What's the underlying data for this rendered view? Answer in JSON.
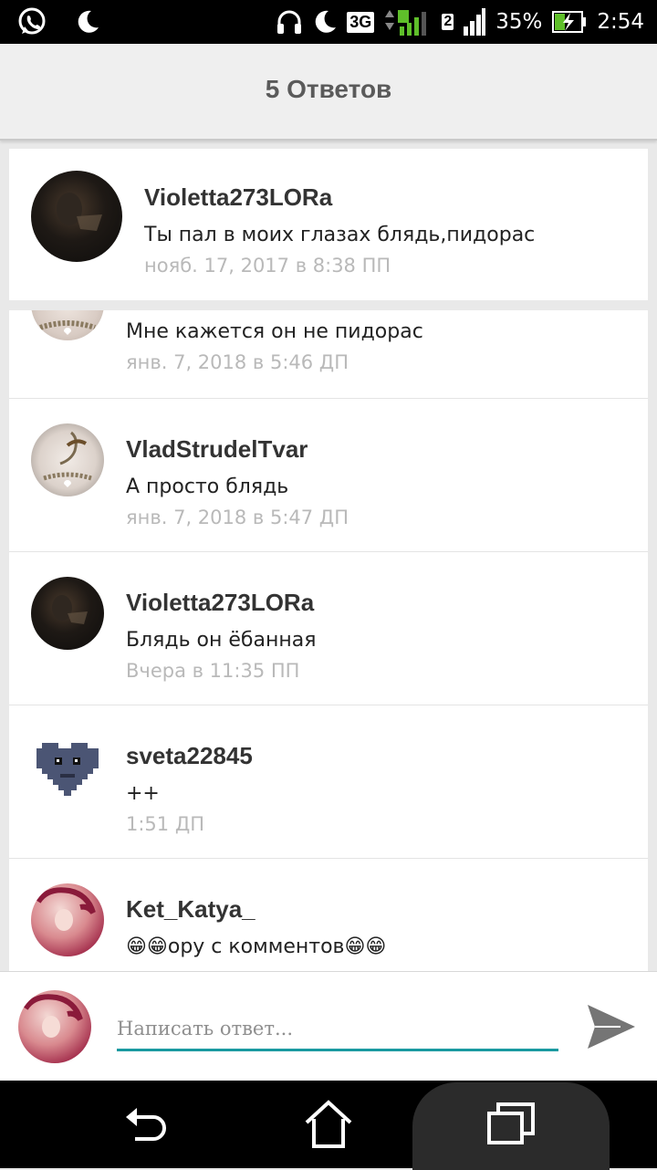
{
  "status_bar": {
    "network": "3G",
    "battery": "35%",
    "time": "2:54",
    "sim2": "2",
    "icons": [
      "whatsapp-icon",
      "moon-icon",
      "headphones-icon",
      "moon-icon",
      "signal-icon",
      "battery-charging-icon"
    ]
  },
  "header": {
    "title": "5 Ответов"
  },
  "main_comment": {
    "username": "Violetta273LORa",
    "text": "Ты пал в моих глазах блядь,пидорас",
    "time": "нояб. 17, 2017 в 8:38 ПП"
  },
  "replies": [
    {
      "username": "",
      "text": "Мне кажется он не пидорас",
      "time": "янв. 7, 2018 в 5:46 ДП",
      "avatar": "avatar-sketch"
    },
    {
      "username": "VladStrudelTvar",
      "text": "А просто блядь",
      "time": "янв. 7, 2018 в 5:47 ДП",
      "avatar": "avatar-sketch"
    },
    {
      "username": "Violetta273LORa",
      "text": "Блядь он ёбанная",
      "time": "Вчера в 11:35 ПП",
      "avatar": "avatar-dark"
    },
    {
      "username": "sveta22845",
      "text": "++",
      "time": "1:51 ДП",
      "avatar": "avatar-pixel-heart"
    },
    {
      "username": "Ket_Katya_",
      "text": "😁😁ору с комментов😁😁",
      "time": "",
      "avatar": "avatar-pink"
    }
  ],
  "composer": {
    "placeholder": "Написать ответ...",
    "value": ""
  },
  "colors": {
    "accent": "#1a9aa0",
    "timestamp": "#b9b9b9",
    "header_bg": "#efefef"
  }
}
